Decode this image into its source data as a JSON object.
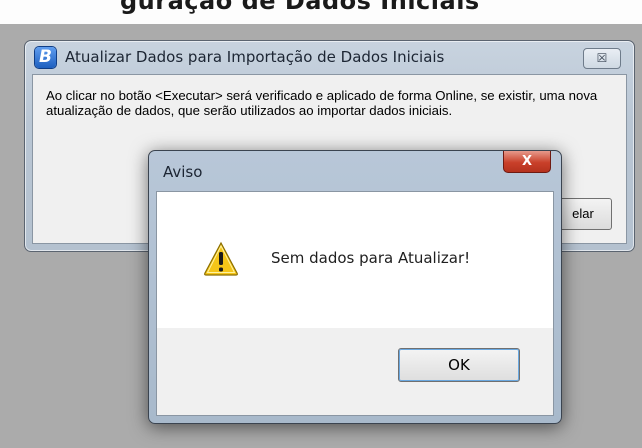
{
  "background": {
    "partial_heading": "guração de Dados Iniciais"
  },
  "main_window": {
    "icon_letter": "B",
    "title": "Atualizar Dados para Importação de Dados Iniciais",
    "close_glyph": "☒",
    "message": "Ao clicar no botão <Executar> será verificado e aplicado de forma Online, se existir, uma nova atualização de dados, que serão utilizados ao importar dados iniciais.",
    "cancel_button_partial_label": "elar"
  },
  "dialog": {
    "title": "Aviso",
    "close_glyph": "X",
    "icon": "warning-icon",
    "message": "Sem dados para Atualizar!",
    "ok_label": "OK"
  },
  "colors": {
    "desktop": "#ababab",
    "close_red": "#c9402a",
    "warning_yellow": "#f5c518"
  }
}
